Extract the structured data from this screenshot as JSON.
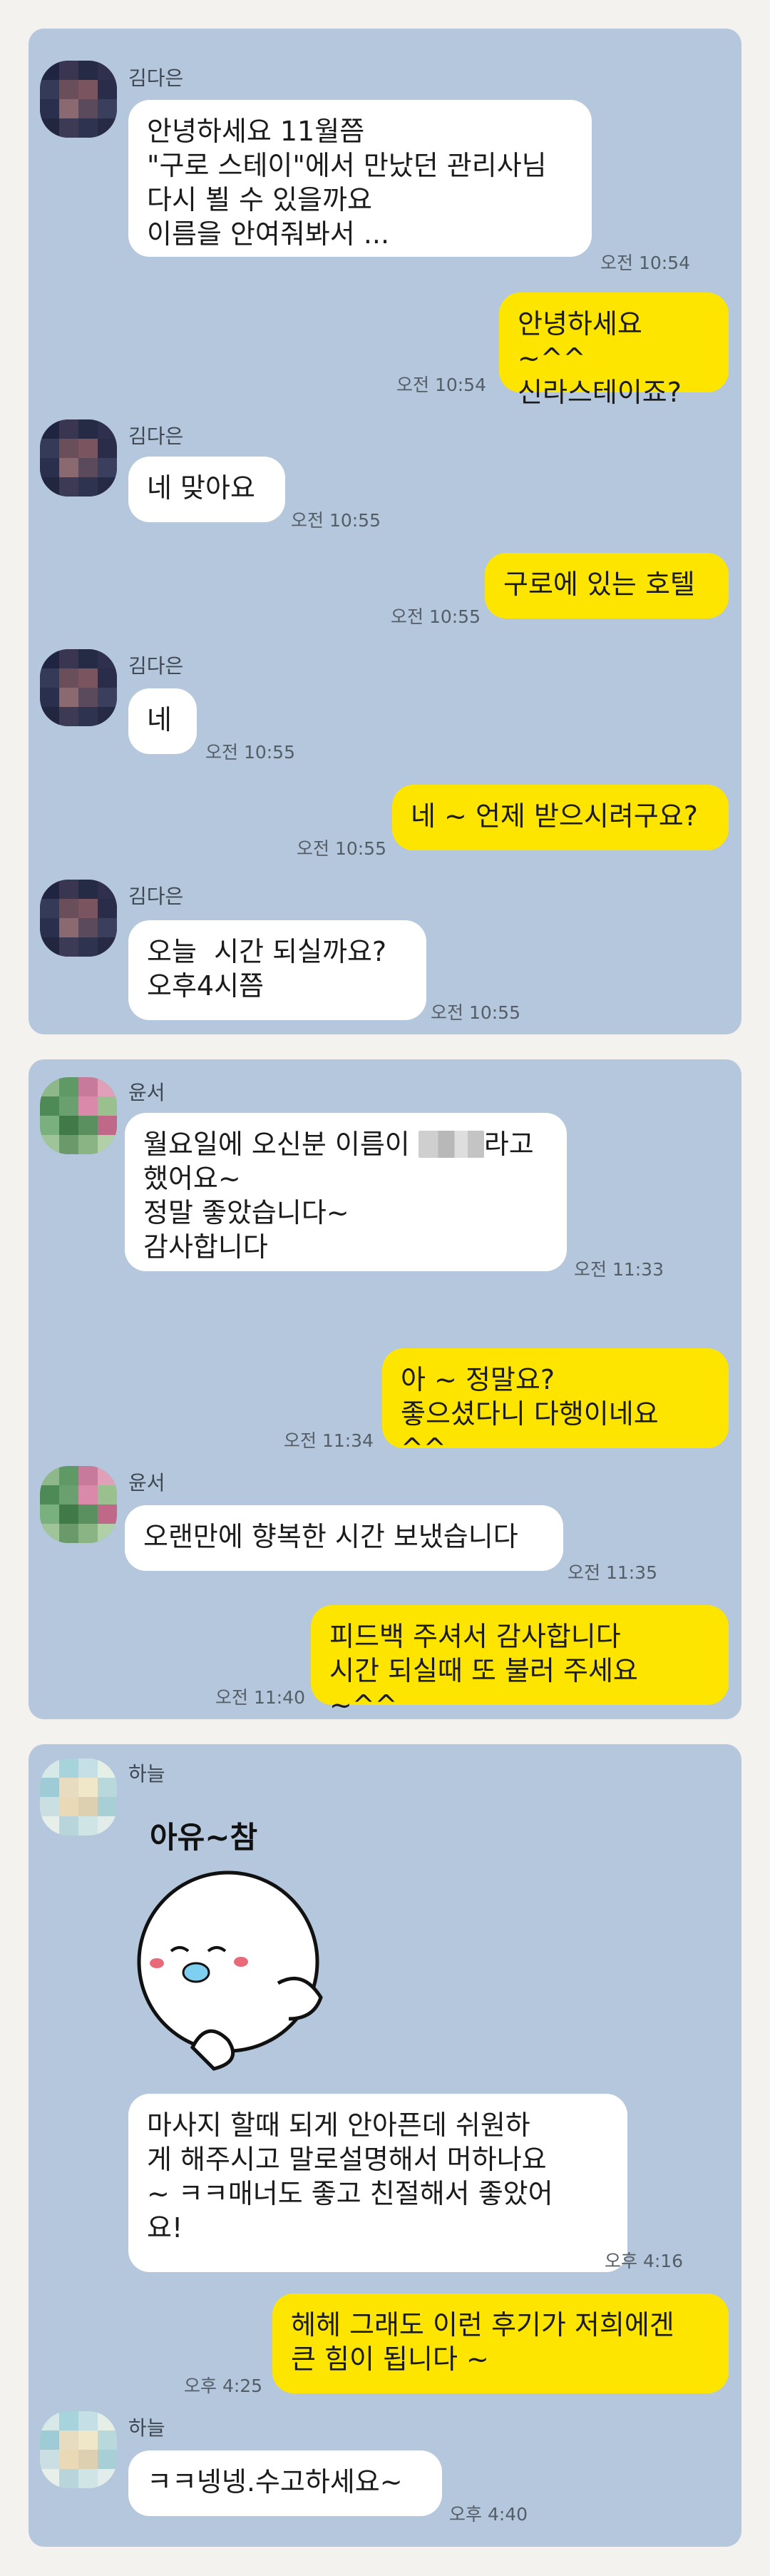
{
  "panel1": {
    "messages": [
      {
        "name": "김다은",
        "text": "안녕하세요 11월쯤\n\"구로 스테이\"에서 만났던 관리사님\n다시 뵐 수 있을까요\n이름을 안여줘봐서 ...",
        "time": "오전 10:54"
      },
      {
        "text": "안녕하세요 ~^^\n신라스테이죠?",
        "time": "오전 10:54"
      },
      {
        "name": "김다은",
        "text": "네 맞아요",
        "time": "오전 10:55"
      },
      {
        "text": "구로에 있는 호텔",
        "time": "오전 10:55"
      },
      {
        "name": "김다은",
        "text": "네",
        "time": "오전 10:55"
      },
      {
        "text": "네 ~ 언제 받으시려구요?",
        "time": "오전 10:55"
      },
      {
        "name": "김다은",
        "text": "오늘  시간 되실까요?\n오후4시쯤",
        "time": "오전 10:55"
      }
    ]
  },
  "panel2": {
    "messages": [
      {
        "name": "윤서",
        "text_before": "월요일에 오신분 이름이 ",
        "text_after": "라고\n했어요~\n정말 좋았습니다~\n감사합니다",
        "time": "오전 11:33"
      },
      {
        "text": "아 ~ 정말요?\n좋으셨다니 다행이네요 ^^",
        "time": "오전 11:34"
      },
      {
        "name": "윤서",
        "text": "오랜만에 향복한 시간 보냈습니다",
        "time": "오전 11:35"
      },
      {
        "text": "피드백 주셔서 감사합니다\n시간 되실때 또 불러 주세요 ~^^",
        "time": "오전 11:40"
      }
    ]
  },
  "panel3": {
    "messages": [
      {
        "name": "하늘",
        "sticker_text": "아유~참",
        "text": "마사지 할때 되게 안아픈데 쉬원하\n게 해주시고 말로설명해서 머하나요\n~ ㅋㅋ매너도 좋고 친절해서 좋았어\n요!",
        "time": "오후 4:16"
      },
      {
        "text": "헤헤 그래도 이런 후기가 저희에겐\n큰 힘이 됩니다 ~",
        "time": "오후 4:25"
      },
      {
        "name": "하늘",
        "text": "ㅋㅋ넹넹.수고하세요~",
        "time": "오후 4:40"
      }
    ]
  },
  "colors": {
    "panel_bg": "#b5c7dc",
    "my_bubble": "#fee500",
    "their_bubble": "#ffffff"
  }
}
